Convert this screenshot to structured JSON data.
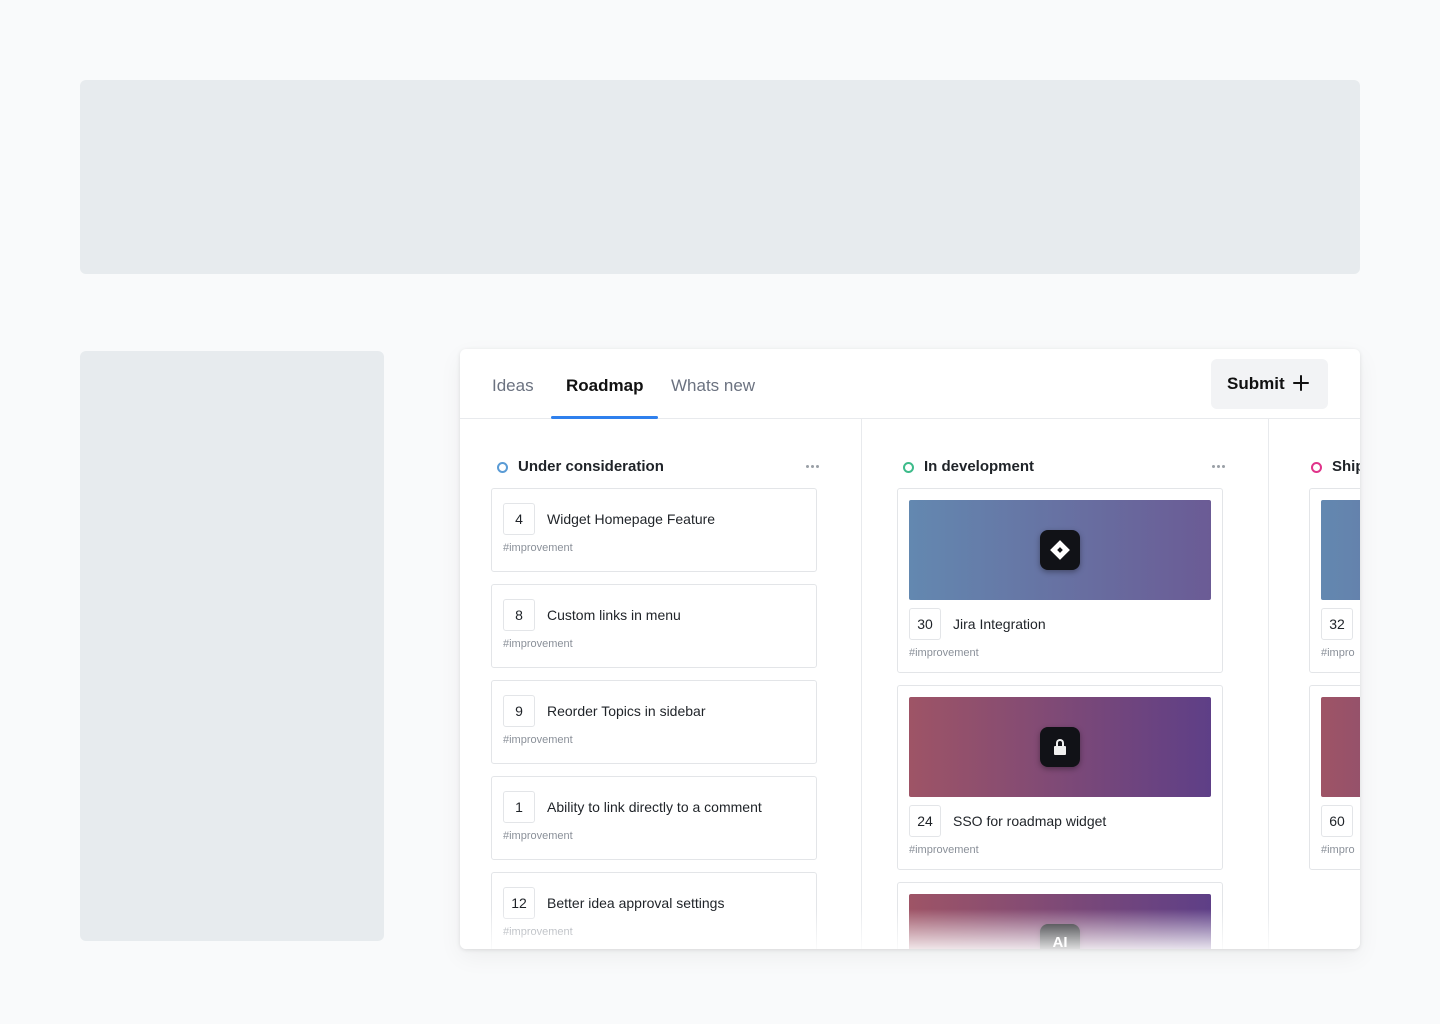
{
  "tabs": [
    {
      "label": "Ideas"
    },
    {
      "label": "Roadmap",
      "active": true
    },
    {
      "label": "Whats new"
    }
  ],
  "submit": {
    "label": "Submit",
    "icon": "plus-icon"
  },
  "colors": {
    "accent": "#2f80ed",
    "under_consideration": "#5a9bd5",
    "in_development": "#3dbb8a",
    "shipped": "#e0338a"
  },
  "columns": [
    {
      "title": "Under consideration",
      "cards": [
        {
          "votes": "4",
          "title": "Widget Homepage Feature",
          "tag": "#improvement"
        },
        {
          "votes": "8",
          "title": "Custom links in menu",
          "tag": "#improvement"
        },
        {
          "votes": "9",
          "title": "Reorder Topics in sidebar",
          "tag": "#improvement"
        },
        {
          "votes": "1",
          "title": "Ability to link directly to a comment",
          "tag": "#improvement"
        },
        {
          "votes": "12",
          "title": "Better idea approval settings",
          "tag": "#improvement"
        }
      ]
    },
    {
      "title": "In development",
      "cards": [
        {
          "votes": "30",
          "title": "Jira Integration",
          "tag": "#improvement",
          "icon": "jira-icon"
        },
        {
          "votes": "24",
          "title": "SSO for roadmap widget",
          "tag": "#improvement",
          "icon": "lock-icon"
        },
        {
          "icon": "ai-icon",
          "icon_text": "AI"
        }
      ]
    },
    {
      "title": "Ship",
      "cards": [
        {
          "votes": "32",
          "tag": "#impro"
        },
        {
          "votes": "60",
          "tag": "#impro"
        }
      ]
    }
  ]
}
